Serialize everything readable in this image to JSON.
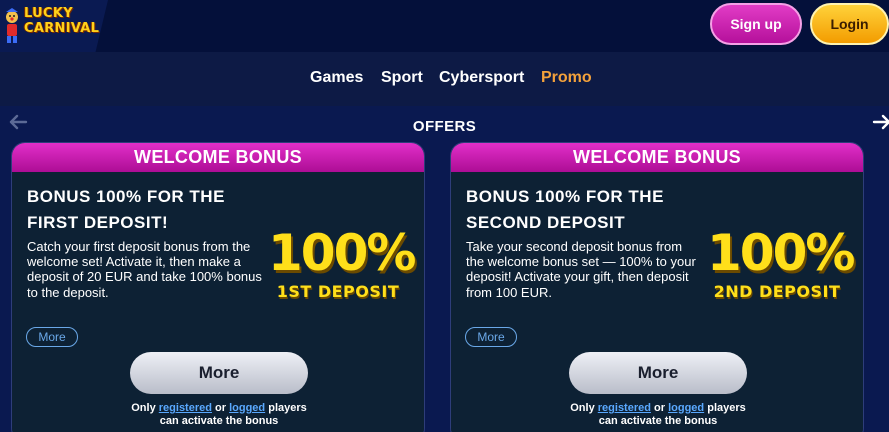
{
  "brand": {
    "name_line1": "LUCKY",
    "name_line2": "CARNIVAL"
  },
  "header": {
    "signup_label": "Sign up",
    "login_label": "Login"
  },
  "nav": {
    "items": [
      {
        "label": "Games"
      },
      {
        "label": "Sport"
      },
      {
        "label": "Cybersport"
      },
      {
        "label": "Promo",
        "active": true
      }
    ]
  },
  "offers": {
    "title": "OFFERS",
    "cards": [
      {
        "header": "WELCOME BONUS",
        "title_line1": "BONUS 100% FOR THE",
        "title_line2": "FIRST DEPOSIT!",
        "description": "Catch your first deposit bonus from the welcome set! Activate it, then make a deposit of 20 EUR and take 100% bonus to the deposit.",
        "badge_value": "100%",
        "badge_label": "1ST DEPOSIT",
        "more_small": "More",
        "more_button": "More",
        "note_only": "Only",
        "note_registered": "registered",
        "note_or": "or",
        "note_logged": "logged",
        "note_players": "players",
        "note_line2": "can activate the bonus"
      },
      {
        "header": "WELCOME BONUS",
        "title_line1": "BONUS 100% FOR THE",
        "title_line2": "SECOND DEPOSIT",
        "description": "Take your second deposit bonus from the welcome bonus set — 100% to your deposit! Activate your gift, then deposit from 100 EUR.",
        "badge_value": "100%",
        "badge_label": "2ND DEPOSIT",
        "more_small": "More",
        "more_button": "More",
        "note_only": "Only",
        "note_registered": "registered",
        "note_or": "or",
        "note_logged": "logged",
        "note_players": "players",
        "note_line2": "can activate the bonus"
      }
    ]
  },
  "colors": {
    "background": "#0d1a45",
    "header_bg": "#04103a",
    "card_header": "#d41fb8",
    "accent_promo": "#f3a13b",
    "badge_yellow": "#ffdf1a",
    "link_blue": "#5aa9ff"
  },
  "icons": {
    "arrow_left": "arrow-left-icon",
    "arrow_right": "arrow-right-icon",
    "logo_mascot": "clown-mascot-icon"
  }
}
